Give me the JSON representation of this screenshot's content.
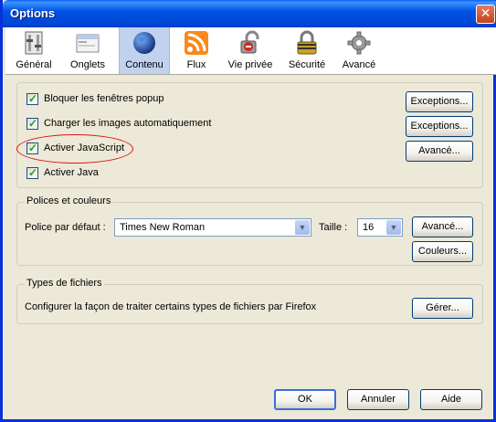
{
  "window": {
    "title": "Options",
    "close_glyph": "✕"
  },
  "toolbar": [
    {
      "label": "Général",
      "icon": "general-icon"
    },
    {
      "label": "Onglets",
      "icon": "tabs-icon"
    },
    {
      "label": "Contenu",
      "icon": "globe-icon",
      "selected": true
    },
    {
      "label": "Flux",
      "icon": "rss-feed-icon"
    },
    {
      "label": "Vie privée",
      "icon": "privacy-lock-icon"
    },
    {
      "label": "Sécurité",
      "icon": "security-padlock-icon"
    },
    {
      "label": "Avancé",
      "icon": "gear-icon"
    }
  ],
  "content": {
    "checkboxes": [
      {
        "label": "Bloquer les fenêtres popup",
        "checked": true
      },
      {
        "label": "Charger les images automatiquement",
        "checked": true
      },
      {
        "label": "Activer JavaScript",
        "checked": true
      },
      {
        "label": "Activer Java",
        "checked": true
      }
    ],
    "buttons": {
      "exceptions_popup": "Exceptions...",
      "exceptions_images": "Exceptions...",
      "advanced_js": "Avancé..."
    }
  },
  "fonts": {
    "legend": "Polices et couleurs",
    "default_font_label": "Police par défaut :",
    "default_font_value": "Times New Roman",
    "size_label": "Taille :",
    "size_value": "16",
    "advanced_button": "Avancé...",
    "colors_button": "Couleurs..."
  },
  "filetypes": {
    "legend": "Types de fichiers",
    "description": "Configurer la façon de traiter certains types de fichiers par Firefox",
    "manage_button": "Gérer..."
  },
  "footer": {
    "ok": "OK",
    "cancel": "Annuler",
    "help": "Aide"
  },
  "colors": {
    "title_bar": "#0055e5",
    "selected_tab": "#c1d2ee",
    "highlight_ellipse": "#dd1111"
  }
}
